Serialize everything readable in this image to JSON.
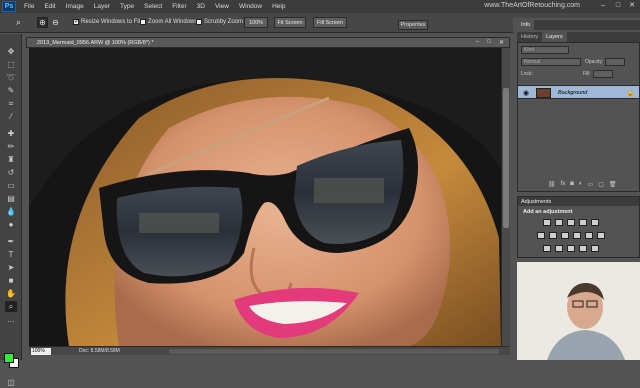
{
  "app": {
    "logo": "Ps",
    "brand": "www.TheArtOfRetouching.com"
  },
  "menu": [
    "File",
    "Edit",
    "Image",
    "Layer",
    "Type",
    "Select",
    "Filter",
    "3D",
    "View",
    "Window",
    "Help"
  ],
  "options_bar": {
    "resize_windows": "Resize Windows to Fit",
    "zoom_all": "Zoom All Windows",
    "scrubby_zoom": "Scrubby Zoom",
    "btn_100": "100%",
    "btn_fit": "Fit Screen",
    "btn_fill": "Fill Screen",
    "resize_checked": true
  },
  "properties_tab": "Properties",
  "document": {
    "title": "2013_Mermaid_0956.ARW @ 100% (RGB/8*) *",
    "zoom": "100%",
    "info": "Doc: 8.58M/8.58M"
  },
  "info_tab": "Info",
  "layers_panel": {
    "tabs": [
      "History",
      "Layers"
    ],
    "active_tab": "Layers",
    "kind_placeholder": "Kind",
    "blend_mode": "Normal",
    "opacity_label": "Opacity:",
    "lock_label": "Lock:",
    "fill_label": "Fill:",
    "layer_name": "Background"
  },
  "adjustments_panel": {
    "title": "Adjustments",
    "subtitle": "Add an adjustment"
  },
  "colors": {
    "foreground": "#39e639",
    "background": "#ffffff"
  }
}
